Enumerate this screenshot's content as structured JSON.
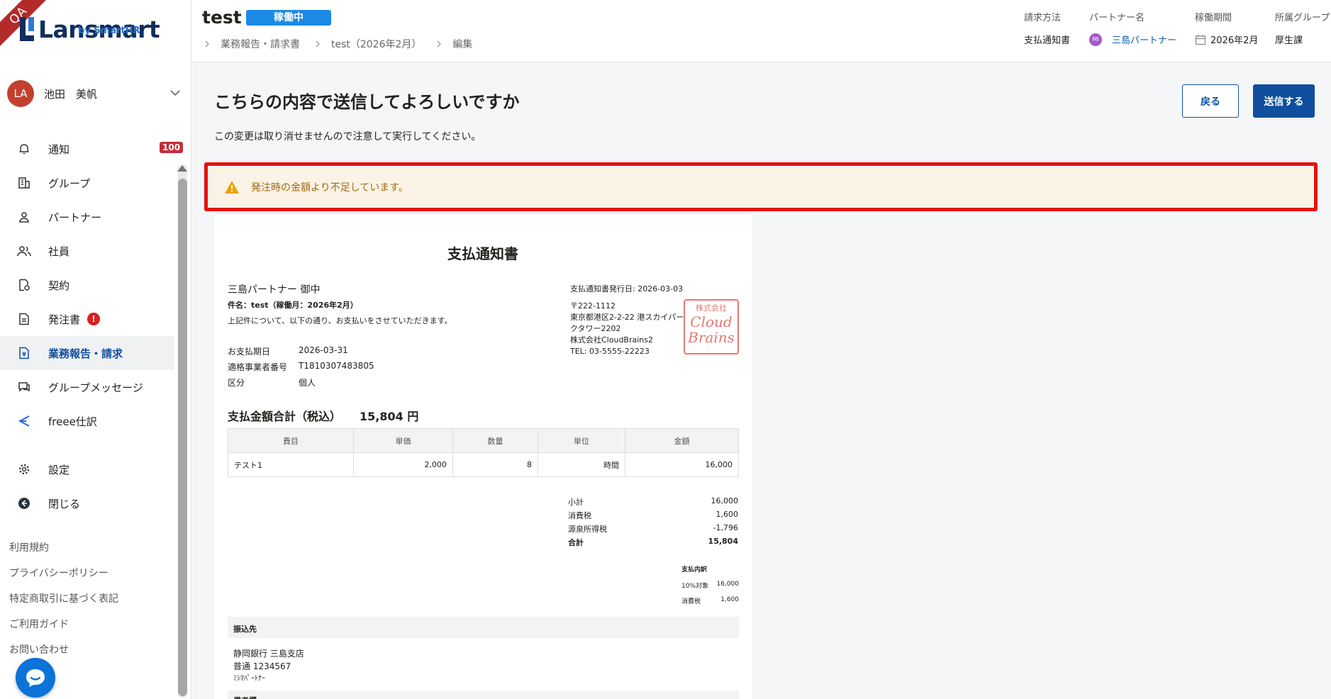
{
  "qa_ribbon": "QA",
  "logo": {
    "name": "Lansmart",
    "sub": "by SmartHR"
  },
  "user": {
    "initials": "LA",
    "name": "池田　美帆"
  },
  "nav": [
    {
      "label": "通知",
      "icon": "bell-icon",
      "badge": "100"
    },
    {
      "label": "グループ",
      "icon": "building-icon"
    },
    {
      "label": "パートナー",
      "icon": "person-icon"
    },
    {
      "label": "社員",
      "icon": "people-icon"
    },
    {
      "label": "契約",
      "icon": "contract-icon"
    },
    {
      "label": "発注書",
      "icon": "document-icon",
      "alert": "!"
    },
    {
      "label": "業務報告・請求",
      "icon": "invoice-icon",
      "active": true
    },
    {
      "label": "グループメッセージ",
      "icon": "chat-icon"
    },
    {
      "label": "freee仕訳",
      "icon": "freee-icon"
    },
    {
      "label": "設定",
      "icon": "gear-icon"
    },
    {
      "label": "閉じる",
      "icon": "collapse-icon"
    }
  ],
  "footer_links": [
    "利用規約",
    "プライバシーポリシー",
    "特定商取引に基づく表記",
    "ご利用ガイド",
    "お問い合わせ"
  ],
  "header": {
    "title": "test",
    "status": "稼働中",
    "breadcrumb": [
      "業務報告・請求書",
      "test（2026年2月）",
      "編集"
    ],
    "meta": [
      {
        "label": "請求方法",
        "value": "支払通知書"
      },
      {
        "label": "パートナー名",
        "value": "三島パートナー",
        "avatar": "MI"
      },
      {
        "label": "稼働期間",
        "value": "2026年2月"
      },
      {
        "label": "所属グループ",
        "value": "厚生課"
      }
    ]
  },
  "main": {
    "title": "こちらの内容で送信してよろしいですか",
    "subtitle": "この変更は取り消せませんので注意して実行してください。",
    "back_label": "戻る",
    "send_label": "送信する",
    "warning": "発注時の金額より不足しています。"
  },
  "doc": {
    "title": "支払通知書",
    "recipient": "三島パートナー 御中",
    "subject": "件名：test（稼働月：2026年2月）",
    "intro": "上記件について、以下の通り、お支払いをさせていただきます。",
    "fields": [
      {
        "k": "お支払期日",
        "v": "2026-03-31"
      },
      {
        "k": "適格事業者番号",
        "v": "T1810307483805"
      },
      {
        "k": "区分",
        "v": "個人"
      }
    ],
    "issuer": {
      "issued": "支払通知書発行日: 2026-03-03",
      "zip": "〒222-1112",
      "address": "東京都港区2-2-22 港スカイパークタワー2202",
      "company": "株式会社CloudBrains2",
      "tel": "TEL: 03-5555-22223"
    },
    "seal": {
      "top": "株式会社",
      "line1": "Cloud",
      "line2": "Brains"
    },
    "total_label": "支払金額合計（税込）",
    "total_value": "15,804 円",
    "table": {
      "headers": [
        "費目",
        "単価",
        "数量",
        "単位",
        "金額"
      ],
      "rows": [
        [
          "テスト1",
          "2,000",
          "8",
          "時間",
          "16,000"
        ]
      ]
    },
    "summary": [
      {
        "k": "小計",
        "v": "16,000"
      },
      {
        "k": "消費税",
        "v": "1,600"
      },
      {
        "k": "源泉所得税",
        "v": "-1,796"
      },
      {
        "k": "合計",
        "v": "15,804",
        "bold": true
      }
    ],
    "breakdown": {
      "title": "支払内訳",
      "rows": [
        {
          "k": "10%対象",
          "v": "16,000"
        },
        {
          "k": "消費税",
          "v": "1,600"
        }
      ]
    },
    "bank_head": "振込先",
    "bank_lines": [
      "静岡銀行 三島支店",
      "普通 1234567",
      "ﾐｼﾏﾊﾟｰﾄﾅｰ"
    ],
    "notes_head": "備考欄"
  }
}
